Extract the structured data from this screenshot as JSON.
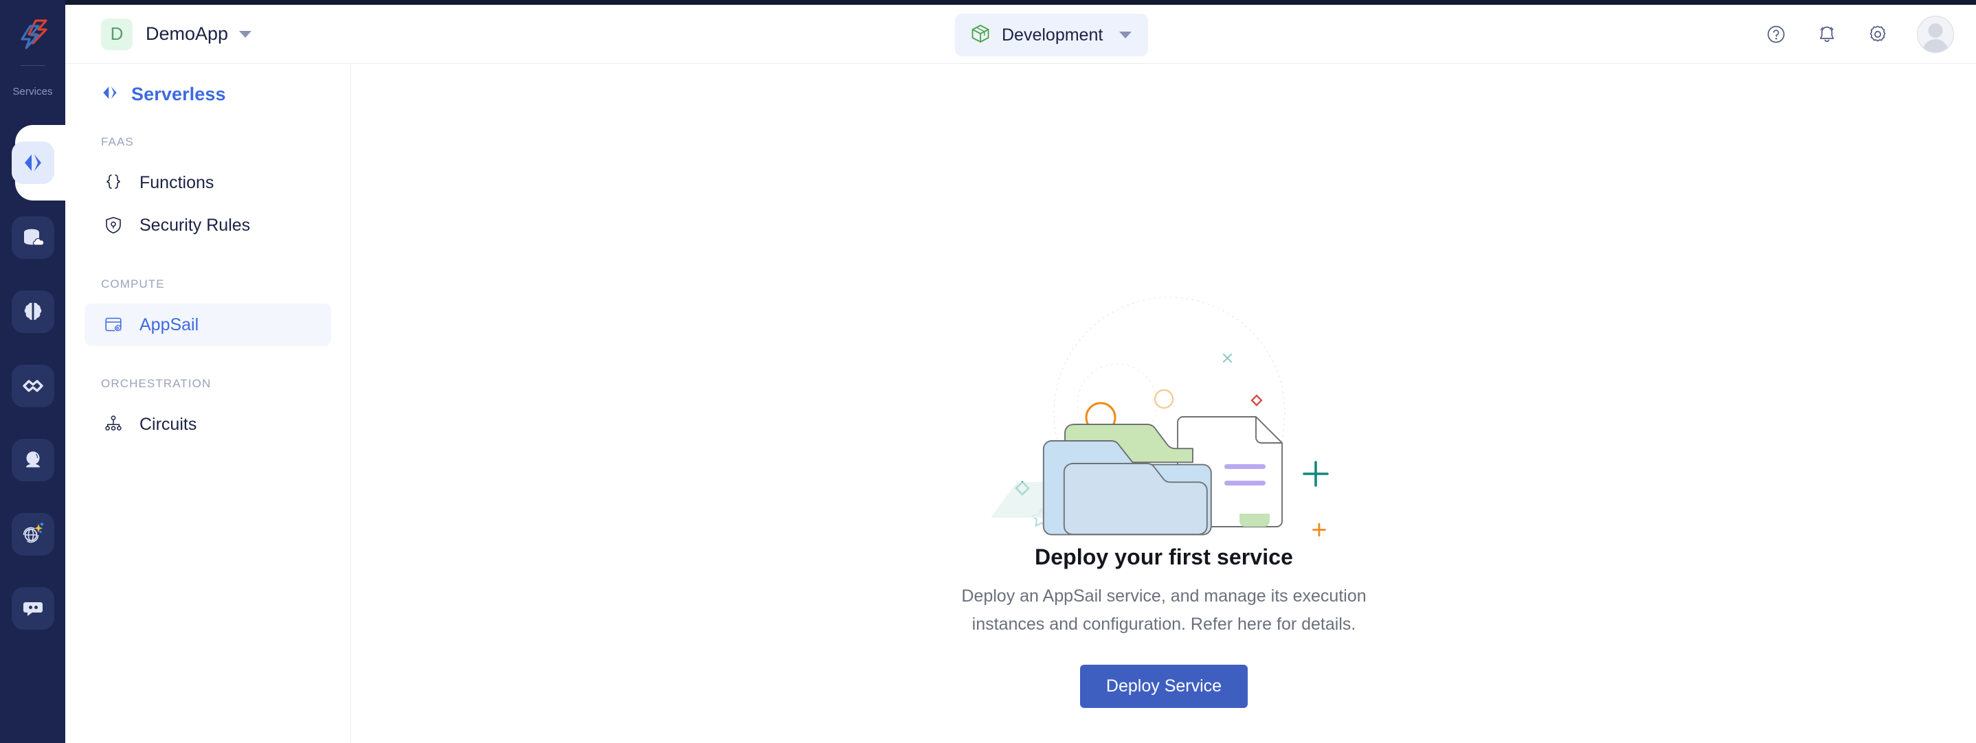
{
  "window": {
    "colors": {
      "rail_bg": "#1c2450",
      "accent_blue": "#3e6ae1",
      "button_blue": "#3f5fc0",
      "active_nav_bg": "#f4f6fd",
      "env_chip_bg": "#eef2fd",
      "app_badge_bg": "#e3f7e8",
      "app_badge_text": "#5a9e6f",
      "border": "#eceef4",
      "muted_text": "#9aa2bd"
    }
  },
  "rail": {
    "logo_icon": "catalyst-chevrons-logo-icon",
    "services_label": "Services",
    "items": [
      {
        "icon": "code-brackets-icon",
        "name": "serverless",
        "active": true
      },
      {
        "icon": "database-cloud-icon",
        "name": "data-store",
        "active": false
      },
      {
        "icon": "brain-icon",
        "name": "ai-ml",
        "active": false
      },
      {
        "icon": "infinity-devops-icon",
        "name": "devops",
        "active": false
      },
      {
        "icon": "crystal-ball-icon",
        "name": "insights",
        "active": false
      },
      {
        "icon": "globe-sparkle-icon",
        "name": "web-ai",
        "active": false
      },
      {
        "icon": "chat-bubble-icon",
        "name": "messaging",
        "active": false
      }
    ]
  },
  "header": {
    "app": {
      "badge_letter": "D",
      "name": "DemoApp",
      "caret_icon": "chevron-down-icon"
    },
    "environment": {
      "icon": "cube-box-icon",
      "name": "Development",
      "caret_icon": "chevron-down-icon"
    },
    "actions": [
      {
        "icon": "help-circle-icon",
        "name": "help"
      },
      {
        "icon": "bell-notification-icon",
        "name": "notifications"
      },
      {
        "icon": "gear-settings-icon",
        "name": "settings"
      }
    ],
    "avatar_name": "user-avatar"
  },
  "sidebar": {
    "title": "Serverless",
    "title_icon": "code-brackets-icon",
    "groups": [
      {
        "label": "FAAS",
        "items": [
          {
            "label": "Functions",
            "icon": "curly-braces-icon",
            "active": false
          },
          {
            "label": "Security Rules",
            "icon": "shield-lock-icon",
            "active": false
          }
        ]
      },
      {
        "label": "COMPUTE",
        "items": [
          {
            "label": "AppSail",
            "icon": "browser-gear-icon",
            "active": true
          }
        ]
      },
      {
        "label": "ORCHESTRATION",
        "items": [
          {
            "label": "Circuits",
            "icon": "sitemap-nodes-icon",
            "active": false
          }
        ]
      }
    ]
  },
  "main": {
    "empty_state": {
      "illustration": "folder-document-empty-illustration",
      "title": "Deploy your first service",
      "description": "Deploy an AppSail service, and manage its execution instances and configuration. Refer here for details.",
      "button_label": "Deploy Service"
    }
  }
}
